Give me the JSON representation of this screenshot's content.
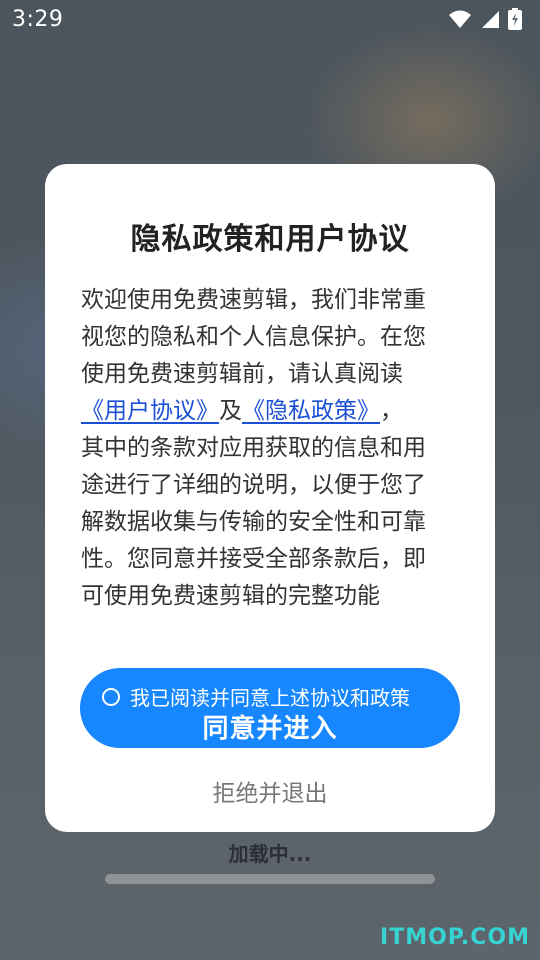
{
  "status_bar": {
    "time": "3:29",
    "icons": [
      "wifi-icon",
      "cellular-signal-icon",
      "battery-charging-icon"
    ]
  },
  "dialog": {
    "title": "隐私政策和用户协议",
    "body_lines": [
      "欢迎使用免费速剪辑，我们非常重",
      "视您的隐私和个人信息保护。在您",
      "使用免费速剪辑前，请认真阅读"
    ],
    "user_agreement_link": "《用户协议》",
    "link_connector": "及",
    "privacy_policy_link": "《隐私政策》",
    "link_trailing": "，",
    "body_lines_after": [
      "其中的条款对应用获取的信息和用",
      "途进行了详细的说明，以便于您了",
      "解数据收集与传输的安全性和可靠",
      "性。您同意并接受全部条款后，即",
      "可使用免费速剪辑的完整功能"
    ],
    "consent_checkbox_label": "我已阅读并同意上述协议和政策",
    "consent_checked": false,
    "agree_button_label": "同意并进入",
    "refuse_label": "拒绝并退出"
  },
  "loading": {
    "label": "加载中...",
    "progress": 0
  },
  "watermark": "ITMOP.COM",
  "colors": {
    "accent": "#1687ff",
    "link": "#1a4fd6",
    "watermark": "#37d2d2"
  }
}
